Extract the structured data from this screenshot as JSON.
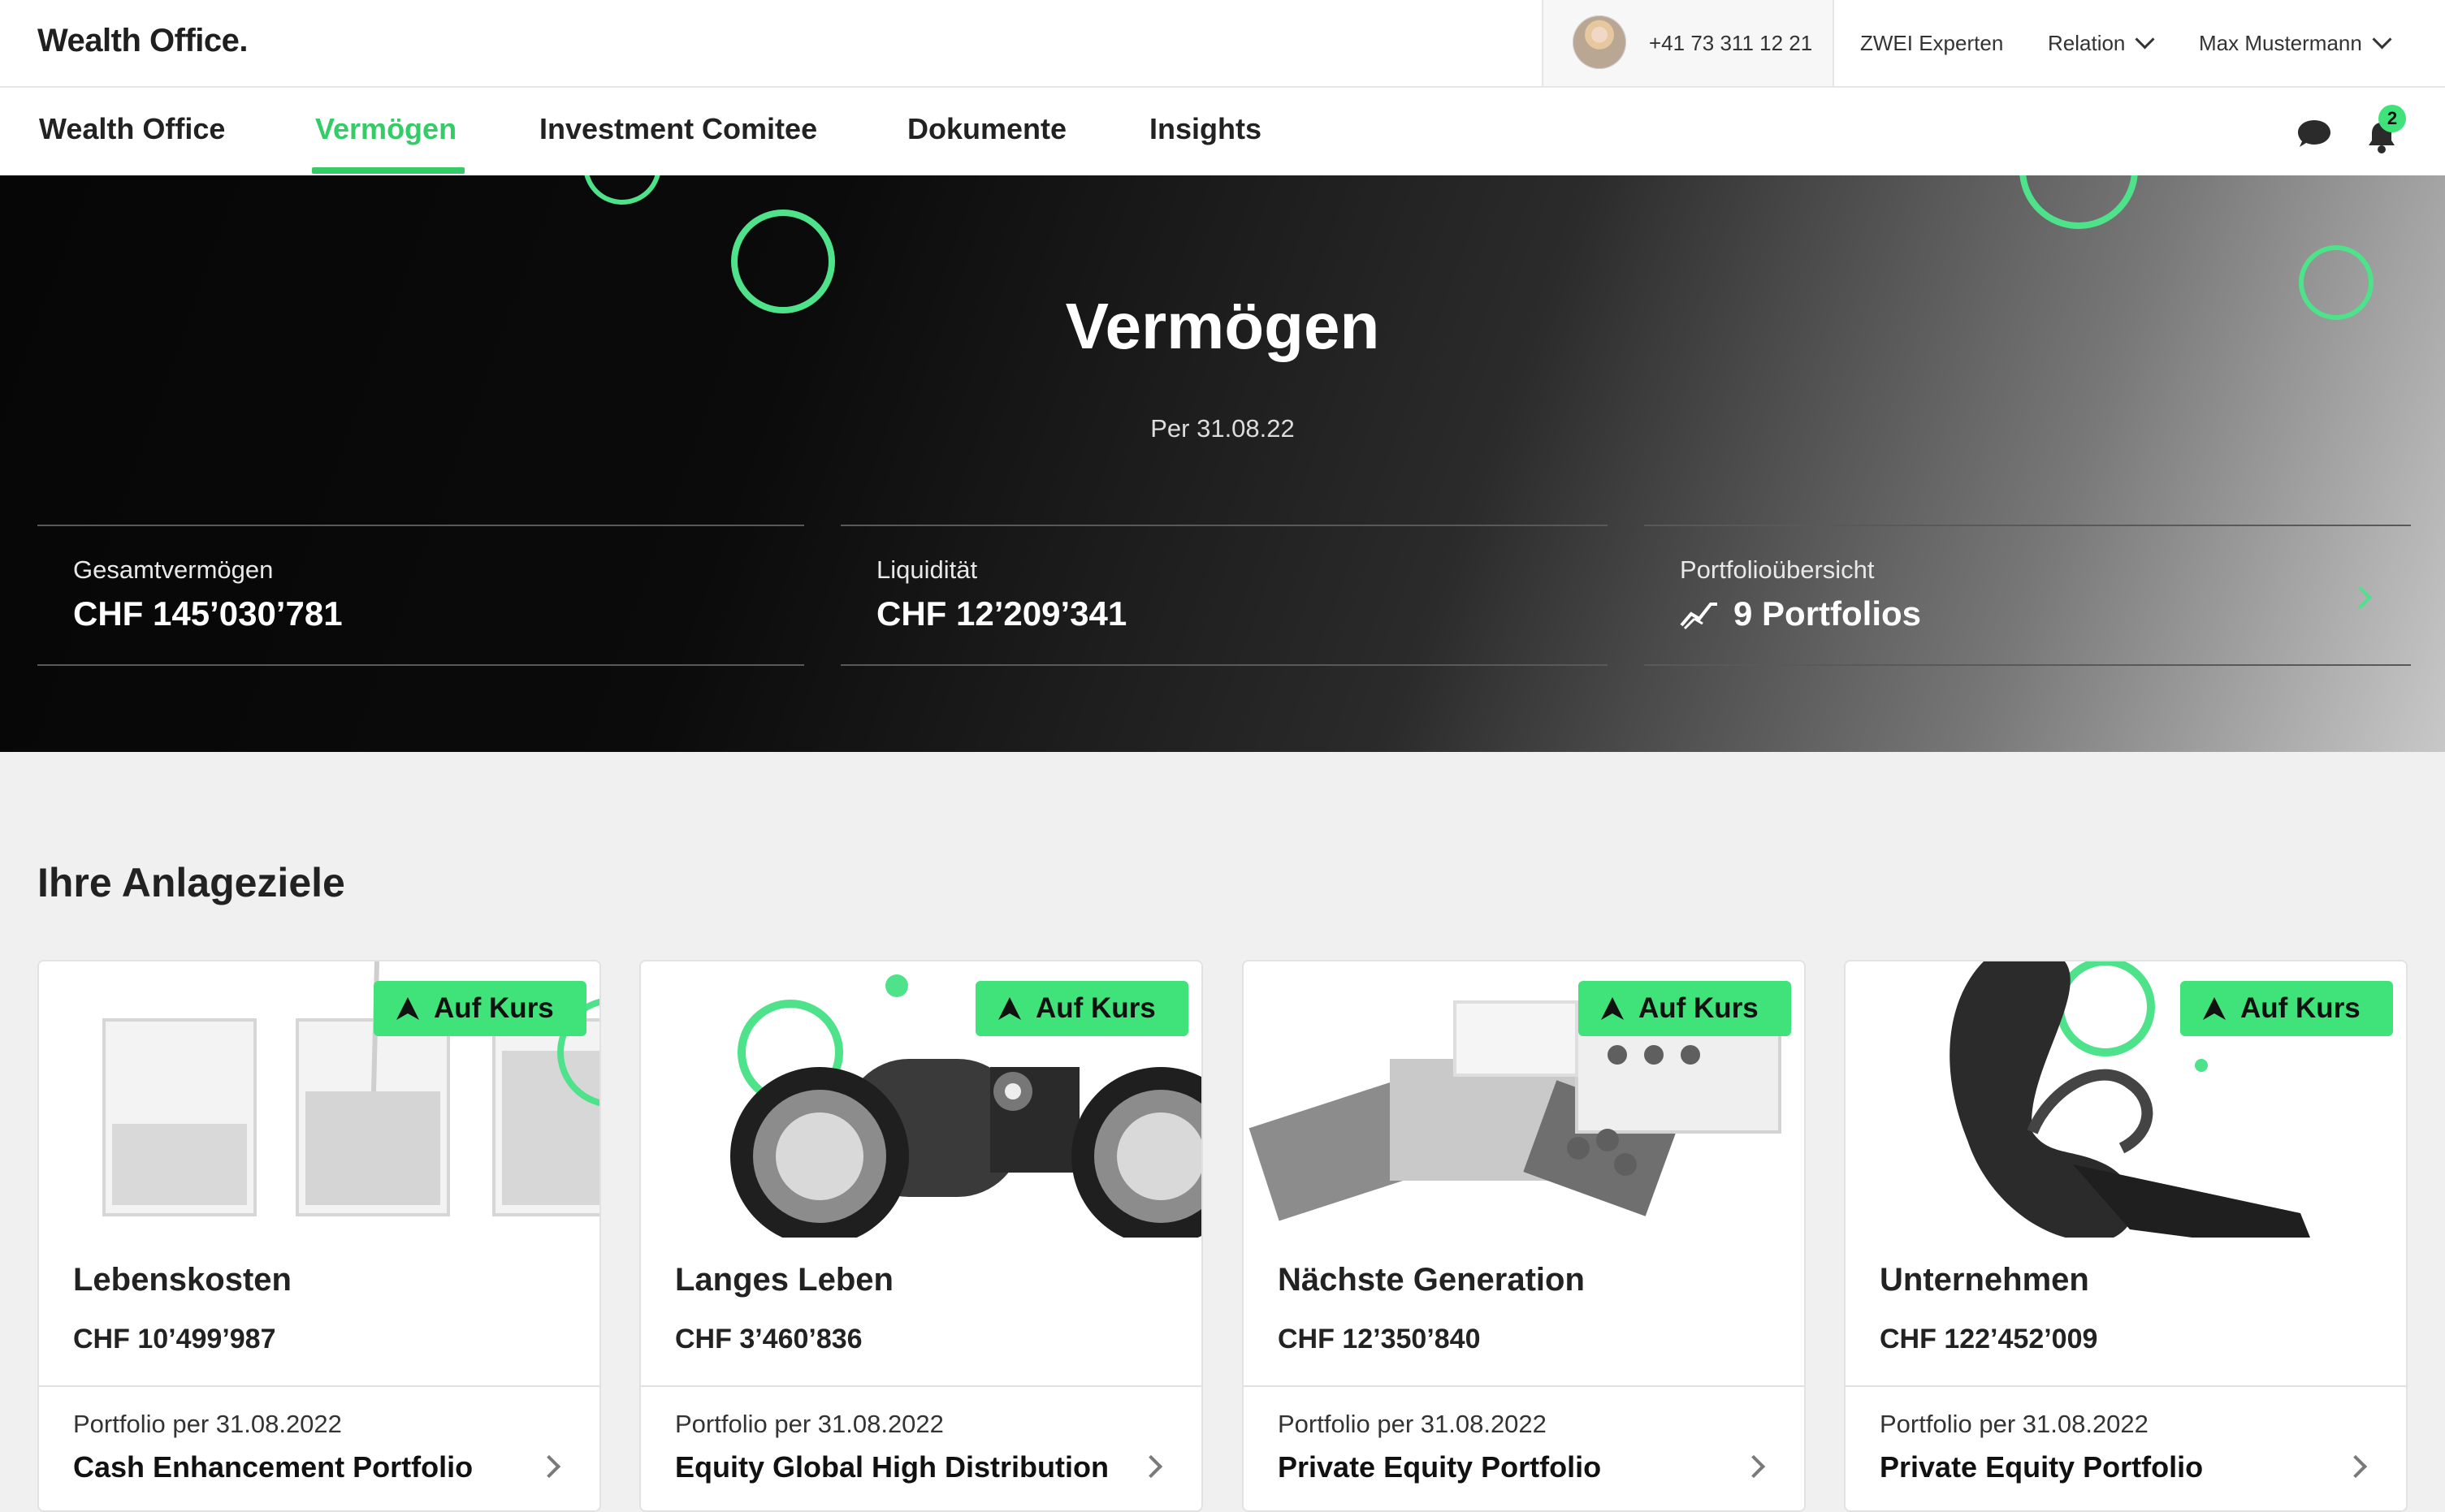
{
  "header": {
    "logo": "Wealth Office.",
    "advisor_phone": "+41 73 311 12 21",
    "links": [
      "ZWEI Experten",
      "Relation",
      "Max Mustermann"
    ]
  },
  "nav": {
    "items": [
      {
        "label": "Wealth Office",
        "active": false
      },
      {
        "label": "Vermögen",
        "active": true
      },
      {
        "label": "Investment Comitee",
        "active": false
      },
      {
        "label": "Dokumente",
        "active": false
      },
      {
        "label": "Insights",
        "active": false
      }
    ],
    "notification_count": "2",
    "icons": [
      "chat-icon",
      "bell-icon"
    ]
  },
  "hero": {
    "title": "Vermögen",
    "date": "Per 31.08.22",
    "stats": [
      {
        "label": "Gesamtvermögen",
        "value": "CHF 145’030’781"
      },
      {
        "label": "Liquidität",
        "value": "CHF 12’209’341"
      },
      {
        "label": "Portfolioübersicht",
        "value": "9 Portfolios"
      }
    ]
  },
  "section": {
    "title": "Ihre Anlageziele"
  },
  "cards": [
    {
      "status": "Auf Kurs",
      "title": "Lebenskosten",
      "amount": "CHF 10’499’987",
      "subtitle": "Portfolio per 31.08.2022",
      "portfolio": "Cash Enhancement Portfolio"
    },
    {
      "status": "Auf Kurs",
      "title": "Langes Leben",
      "amount": "CHF 3’460’836",
      "subtitle": "Portfolio per 31.08.2022",
      "portfolio": "Equity Global High Distribution"
    },
    {
      "status": "Auf Kurs",
      "title": "Nächste Generation",
      "amount": "CHF 12’350’840",
      "subtitle": "Portfolio per 31.08.2022",
      "portfolio": "Private Equity Portfolio"
    },
    {
      "status": "Auf Kurs",
      "title": "Unternehmen",
      "amount": "CHF 122’452’009",
      "subtitle": "Portfolio per 31.08.2022",
      "portfolio": "Private Equity Portfolio"
    }
  ],
  "colors": {
    "accent": "#33cc66",
    "badge": "#3fe37a",
    "hero_dark": "#0b0b0b"
  }
}
